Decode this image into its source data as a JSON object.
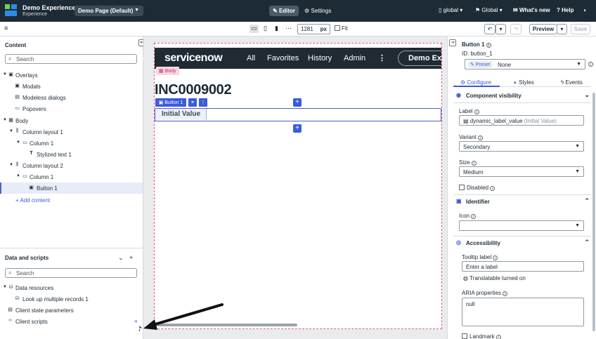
{
  "topbar": {
    "app_title": "Demo Experience",
    "app_subtitle": "Experience",
    "page_selector": "Demo Page (Default)",
    "editor_label": "Editor",
    "settings_label": "Settings",
    "scope_label": "global",
    "language_label": "Global",
    "whats_new_label": "What's new",
    "help_label": "Help"
  },
  "toolbar": {
    "viewport_width": "1281",
    "viewport_unit": "px",
    "fit_label": "Fit",
    "preview_label": "Preview",
    "save_label": "Save"
  },
  "content_panel": {
    "title": "Content",
    "search_placeholder": "Search",
    "tree": [
      {
        "label": "Overlays",
        "icon": "layout-icon"
      },
      {
        "label": "Modals",
        "icon": "modal-icon"
      },
      {
        "label": "Modeless dialogs",
        "icon": "dialog-icon"
      },
      {
        "label": "Popovers",
        "icon": "popover-icon"
      },
      {
        "label": "Body",
        "icon": "grid-icon"
      },
      {
        "label": "Column layout 1",
        "icon": "columns-icon"
      },
      {
        "label": "Column 1",
        "icon": "column-icon"
      },
      {
        "label": "Stylized text 1",
        "icon": "text-icon"
      },
      {
        "label": "Column layout 2",
        "icon": "columns-icon"
      },
      {
        "label": "Column 1",
        "icon": "column-icon"
      },
      {
        "label": "Button 1",
        "icon": "button-icon"
      }
    ],
    "add_content_label": "Add content"
  },
  "data_panel": {
    "title": "Data and scripts",
    "search_placeholder": "Search",
    "tree": [
      {
        "label": "Data resources"
      },
      {
        "label": "Look up multiple records 1"
      },
      {
        "label": "Client state parameters"
      },
      {
        "label": "Client scripts"
      }
    ]
  },
  "canvas": {
    "body_tag": "Body",
    "nav": {
      "logo": "servicenow",
      "links": [
        "All",
        "Favorites",
        "History",
        "Admin"
      ],
      "pill": "Demo Expe"
    },
    "heading": "INC0009002",
    "selected_chip": "Button 1",
    "button_text": "Initial Value"
  },
  "config_panel": {
    "title": "Button 1",
    "id_label": "ID:",
    "id_value": "button_1",
    "preset_chip": "Preset",
    "preset_value": "None",
    "tabs": [
      "Configure",
      "Styles",
      "Events"
    ],
    "sections": {
      "visibility": "Component visibility",
      "identifier": "Identifier",
      "accessibility": "Accessibility"
    },
    "label_field_label": "Label",
    "label_value": "dynamic_label_value",
    "label_hint": "(Initial Value)",
    "variant_label": "Variant",
    "variant_value": "Secondary",
    "size_label": "Size",
    "size_value": "Medium",
    "disabled_label": "Disabled",
    "icon_label": "Icon",
    "tooltip_label": "Tooltip label",
    "tooltip_placeholder": "Enter a label",
    "translatable_note": "Translatable turned on",
    "aria_label": "ARIA properties",
    "aria_value": "null",
    "landmark_label": "Landmark"
  },
  "colors": {
    "topbar": "#1c2b36",
    "accent": "#3b5bdb",
    "body_tag": "#c7326a"
  }
}
